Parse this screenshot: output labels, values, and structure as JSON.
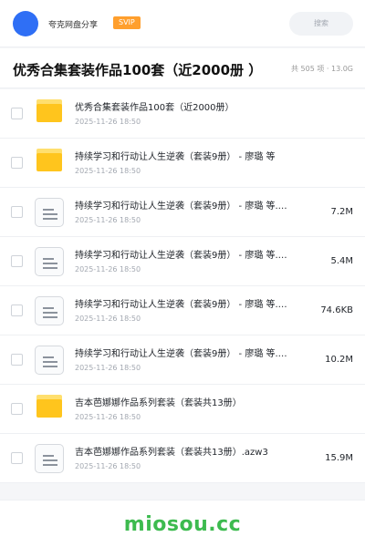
{
  "header": {
    "share_name": "夸克网盘分享",
    "vip_label": "SVIP",
    "search_placeholder": "搜索"
  },
  "title_bar": {
    "title": "优秀合集套装作品100套（近2000册 ）",
    "summary": "共 505 项 · 13.0G"
  },
  "items": [
    {
      "type": "folder",
      "name": "优秀合集套装作品100套（近2000册）",
      "date": "2025-11-26 18:50",
      "size": ""
    },
    {
      "type": "folder",
      "name": "持续学习和行动让人生逆袭（套装9册） - 廖璐 等",
      "date": "2025-11-26 18:50",
      "size": ""
    },
    {
      "type": "file",
      "name": "持续学习和行动让人生逆袭（套装9册） - 廖璐 等.…",
      "date": "2025-11-26 18:50",
      "size": "7.2M"
    },
    {
      "type": "file",
      "name": "持续学习和行动让人生逆袭（套装9册） - 廖璐 等.…",
      "date": "2025-11-26 18:50",
      "size": "5.4M"
    },
    {
      "type": "file",
      "name": "持续学习和行动让人生逆袭（套装9册） - 廖璐 等.…",
      "date": "2025-11-26 18:50",
      "size": "74.6KB"
    },
    {
      "type": "file",
      "name": "持续学习和行动让人生逆袭（套装9册） - 廖璐 等.…",
      "date": "2025-11-26 18:50",
      "size": "10.2M"
    },
    {
      "type": "folder",
      "name": "吉本芭娜娜作品系列套装（套装共13册）",
      "date": "2025-11-26 18:50",
      "size": ""
    },
    {
      "type": "file",
      "name": "吉本芭娜娜作品系列套装（套装共13册）.azw3",
      "date": "2025-11-26 18:50",
      "size": "15.9M"
    }
  ],
  "footer": {
    "watermark": "miosou.cc"
  },
  "colors": {
    "brand_blue": "#2f6ff5",
    "vip_orange": "#ff9f2d",
    "folder_yellow": "#ffc51d",
    "watermark_green": "#3dbb4f"
  },
  "icons": {
    "folder": "folder-icon",
    "file": "document-icon"
  }
}
